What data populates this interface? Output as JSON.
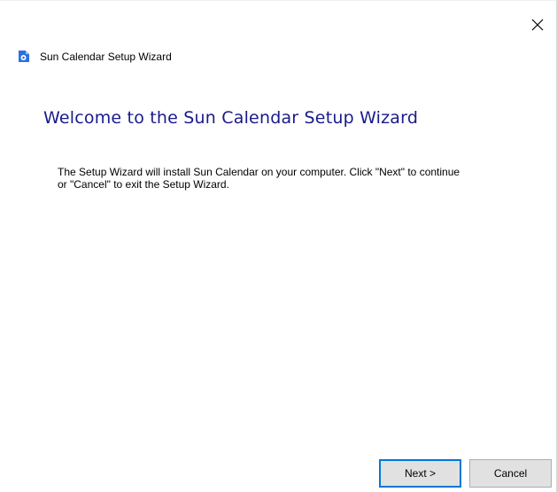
{
  "window": {
    "title": "Sun Calendar Setup Wizard",
    "close_icon": "close-icon",
    "app_icon": "setup-wizard-icon"
  },
  "content": {
    "heading": "Welcome to the Sun Calendar Setup Wizard",
    "line1": "The Setup Wizard will install Sun Calendar on your computer.  Click \"Next\" to continue",
    "line2": "or \"Cancel\" to exit the Setup Wizard."
  },
  "buttons": {
    "next_label": "Next >",
    "cancel_label": "Cancel"
  },
  "colors": {
    "heading": "#1a1a8c",
    "icon_blue": "#2e6fe0",
    "focus_border": "#0078d7"
  }
}
